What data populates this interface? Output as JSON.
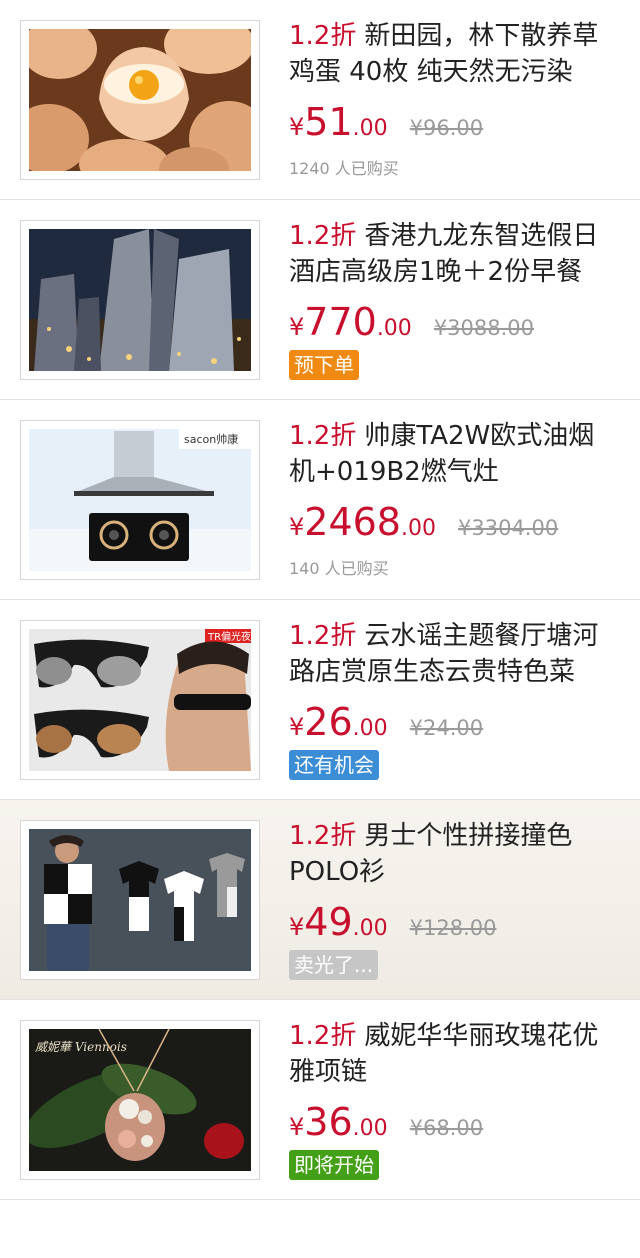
{
  "items": [
    {
      "discount": "1.2折",
      "name": "新田园，林下散养草鸡蛋 40枚 纯天然无污染",
      "currency": "¥",
      "price_int": "51",
      "price_dec": ".00",
      "original_price": "¥96.00",
      "sold_count": "1240 人已购买",
      "image": "eggs-photo"
    },
    {
      "discount": "1.2折",
      "name": "香港九龙东智选假日酒店高级房1晚＋2份早餐",
      "currency": "¥",
      "price_int": "770",
      "price_dec": ".00",
      "original_price": "¥3088.00",
      "badge": {
        "label": "预下单",
        "color": "#f08a12"
      },
      "image": "city-skyline-photo"
    },
    {
      "discount": "1.2折",
      "name": "帅康TA2W欧式油烟机+019B2燃气灶",
      "currency": "¥",
      "price_int": "2468",
      "price_dec": ".00",
      "original_price": "¥3304.00",
      "sold_count": "140 人已购买",
      "image": "range-hood-photo",
      "image_text": "sacon帅康"
    },
    {
      "discount": "1.2折",
      "name": "云水谣主题餐厅塘河路店赏原生态云贵特色菜",
      "currency": "¥",
      "price_int": "26",
      "price_dec": ".00",
      "original_price": "¥24.00",
      "badge": {
        "label": "还有机会",
        "color": "#3b8dd6"
      },
      "image": "sunglasses-photo",
      "image_text": "TR偏光夜"
    },
    {
      "discount": "1.2折",
      "name": "男士个性拼接撞色POLO衫",
      "currency": "¥",
      "price_int": "49",
      "price_dec": ".00",
      "original_price": "¥128.00",
      "badge": {
        "label": "卖光了...",
        "color": "#c6c6c6"
      },
      "soldout": true,
      "image": "polo-shirt-photo"
    },
    {
      "discount": "1.2折",
      "name": "威妮华华丽玫瑰花优雅项链",
      "currency": "¥",
      "price_int": "36",
      "price_dec": ".00",
      "original_price": "¥68.00",
      "badge": {
        "label": "即将开始",
        "color": "#44a017"
      },
      "image": "necklace-photo",
      "image_text": "威妮華 Viennois"
    }
  ]
}
